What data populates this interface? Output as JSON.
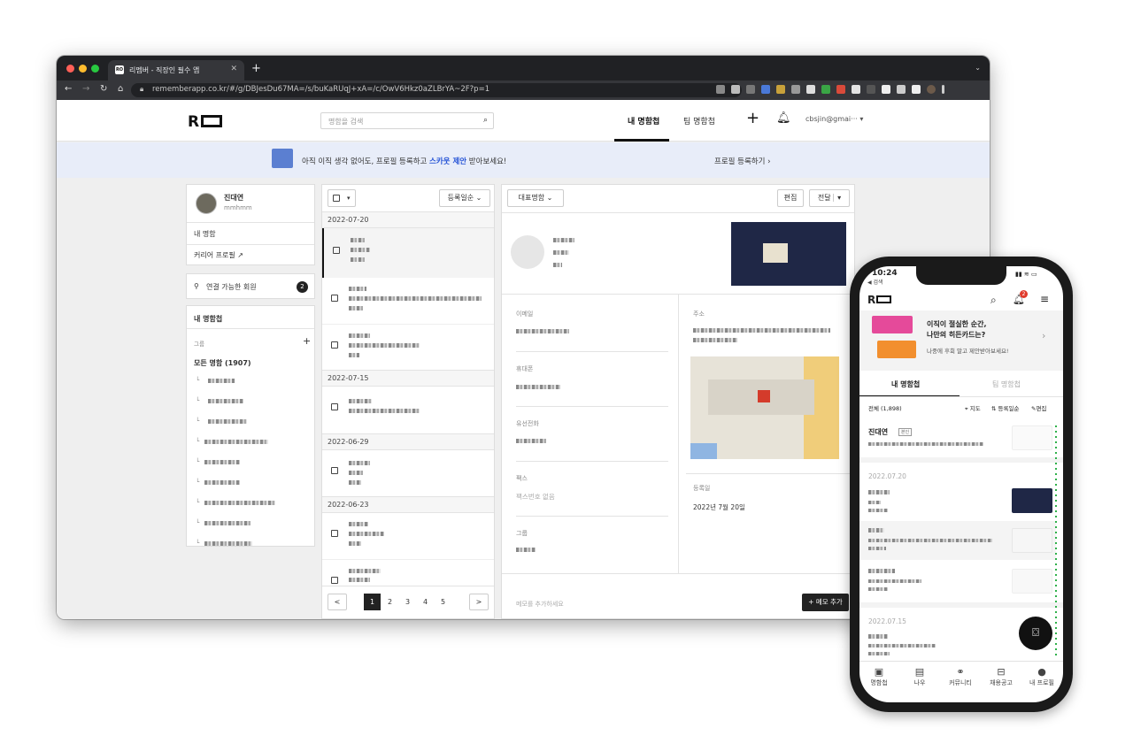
{
  "browser": {
    "tab_title": "리멤버 - 직장인 필수 앱",
    "tab_favicon": "RO",
    "url": "rememberapp.co.kr/#/g/DBJesDu67MA=/s/buKaRUqJ+xA=/c/OwV6Hkz0aZLBrYA~2F?p=1"
  },
  "header": {
    "logo": "R",
    "search_placeholder": "명함을 검색",
    "tab_my_cards": "내 명함첩",
    "tab_team_cards": "팀 명함첩",
    "account": "cbsjin@gmai··· ▾"
  },
  "banner": {
    "text_before": "아직 이직 생각 없어도, 프로필 등록하고 ",
    "text_highlight": "스카웃 제안",
    "text_after": " 받아보세요!",
    "cta": "프로필 등록하기"
  },
  "profile": {
    "name": "진대연",
    "sub": "mmhmm",
    "my_card": "내 명함",
    "career_profile": "커리어 프로필",
    "connectable": "연결 가능한 회원",
    "connectable_count": "2"
  },
  "groups": {
    "title": "내 명함첩",
    "group_label": "그룹",
    "all_cards": "모든 명함 (1907)"
  },
  "card_list": {
    "sort": "등록일순",
    "dates": [
      "2022-07-20",
      "2022-07-15",
      "2022-06-29",
      "2022-06-23"
    ],
    "pages": [
      "1",
      "2",
      "3",
      "4",
      "5"
    ],
    "prev": "<",
    "next": ">"
  },
  "detail": {
    "dropdown": "대표명함",
    "edit": "편집",
    "forward": "전달",
    "email_label": "이메일",
    "mobile_label": "휴대폰",
    "phone_label": "유선전화",
    "fax_label": "팩스",
    "fax_value": "팩스번호 없음",
    "group_label": "그룹",
    "address_label": "주소",
    "reg_date_label": "등록일",
    "reg_date_value": "2022년 7월 20일",
    "memo_placeholder": "메모를 추가하세요",
    "add_memo": "+ 메모 추가"
  },
  "phone": {
    "time": "10:24",
    "back": "◀ 검색",
    "badge": "2",
    "promo_title": "이직이 절실한 순간,\n나만의 히든카드는?",
    "promo_sub": "나중에 후회 말고 제안받아보세요!",
    "tab_my": "내 명함첩",
    "tab_team": "팀 명함첩",
    "all": "전체 (1,898)",
    "map": "지도",
    "sort": "등록일순",
    "edit": "편집",
    "my_name": "진대연",
    "my_tag": "본인",
    "date1": "2022.07.20",
    "date2": "2022.07.15",
    "nav": [
      "명함첩",
      "나우",
      "커뮤니티",
      "채용공고",
      "내 프로필"
    ]
  },
  "colors": {
    "banner_bg": "#e8edf9",
    "highlight": "#2553d6",
    "fab": "#111111"
  }
}
